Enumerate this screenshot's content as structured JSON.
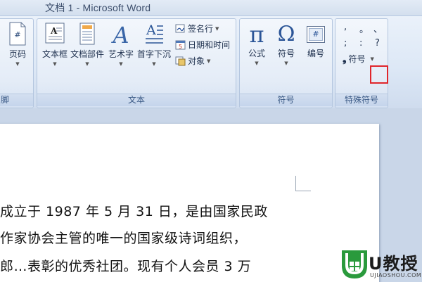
{
  "window": {
    "title": "文档 1 - Microsoft Word"
  },
  "ribbon": {
    "partial_group_label": "脚",
    "page_number_label": "页码",
    "text_group": {
      "label": "文本",
      "textbox": "文本框",
      "quickparts": "文档部件",
      "wordart": "艺术字",
      "dropcap": "首字下沉",
      "signature_line": "签名行",
      "date_time": "日期和时间",
      "object": "对象"
    },
    "symbols_group": {
      "label": "符号",
      "equation": "公式",
      "symbol": "符号",
      "numbering": "编号",
      "pi_glyph": "π",
      "omega_glyph": "Ω",
      "number_glyph": "#"
    },
    "special_symbols_group": {
      "label": "特殊符号",
      "symbols_button": "符号",
      "glyphs": [
        ",",
        "。",
        "、",
        ";",
        ":",
        "?"
      ]
    }
  },
  "document": {
    "lines": [
      "成立于 1987 年 5 月 31 日，是由国家民政",
      "作家协会主管的唯一的国家级诗词组织，",
      "郎…表彰的优秀社团。现有个人会员 3 万"
    ]
  },
  "watermark": {
    "brand": "U教授",
    "url": "UJIAOSHOU.COM"
  },
  "colors": {
    "accent_highlight": "#e0262b",
    "watermark_green": "#2a9a3c"
  }
}
